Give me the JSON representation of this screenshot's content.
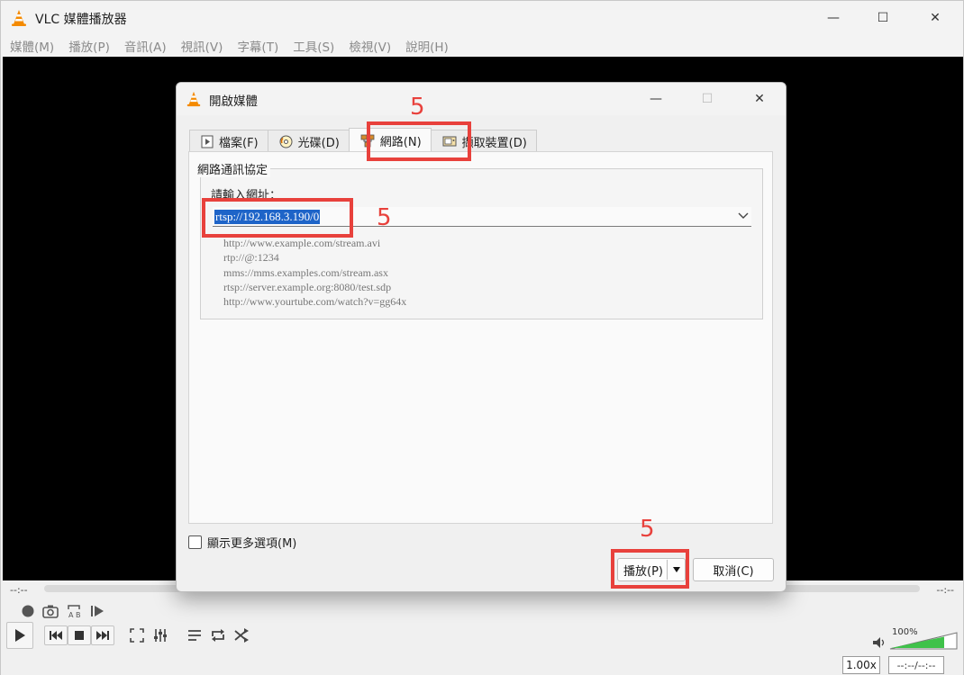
{
  "main_window": {
    "title": "VLC 媒體播放器",
    "controls": {
      "minimize": "—",
      "maximize": "☐",
      "close": "✕"
    },
    "menu": [
      "媒體(M)",
      "播放(P)",
      "音訊(A)",
      "視訊(V)",
      "字幕(T)",
      "工具(S)",
      "檢視(V)",
      "說明(H)"
    ],
    "time_left": "--:--",
    "time_right": "--:--",
    "volume": "100%",
    "speed": "1.00x",
    "time_display": "--:--/--:--"
  },
  "dialog": {
    "title": "開啟媒體",
    "tabs": [
      {
        "label": "檔案(F)",
        "icon": "file-play-icon"
      },
      {
        "label": "光碟(D)",
        "icon": "disc-icon"
      },
      {
        "label": "網路(N)",
        "icon": "network-icon",
        "active": true
      },
      {
        "label": "擷取裝置(D)",
        "icon": "capture-device-icon"
      }
    ],
    "group_title": "網路通訊協定",
    "url_label": "請輸入網址：",
    "url_value": "rtsp://192.168.3.190/0",
    "examples": [
      "http://www.example.com/stream.avi",
      "rtp://@:1234",
      "mms://mms.examples.com/stream.asx",
      "rtsp://server.example.org:8080/test.sdp",
      "http://www.yourtube.com/watch?v=gg64x"
    ],
    "more_options": "顯示更多選項(M)",
    "play_button": "播放(P)",
    "cancel_button": "取消(C)"
  },
  "annotations": {
    "step_number": "5",
    "color": "#e8413c"
  }
}
